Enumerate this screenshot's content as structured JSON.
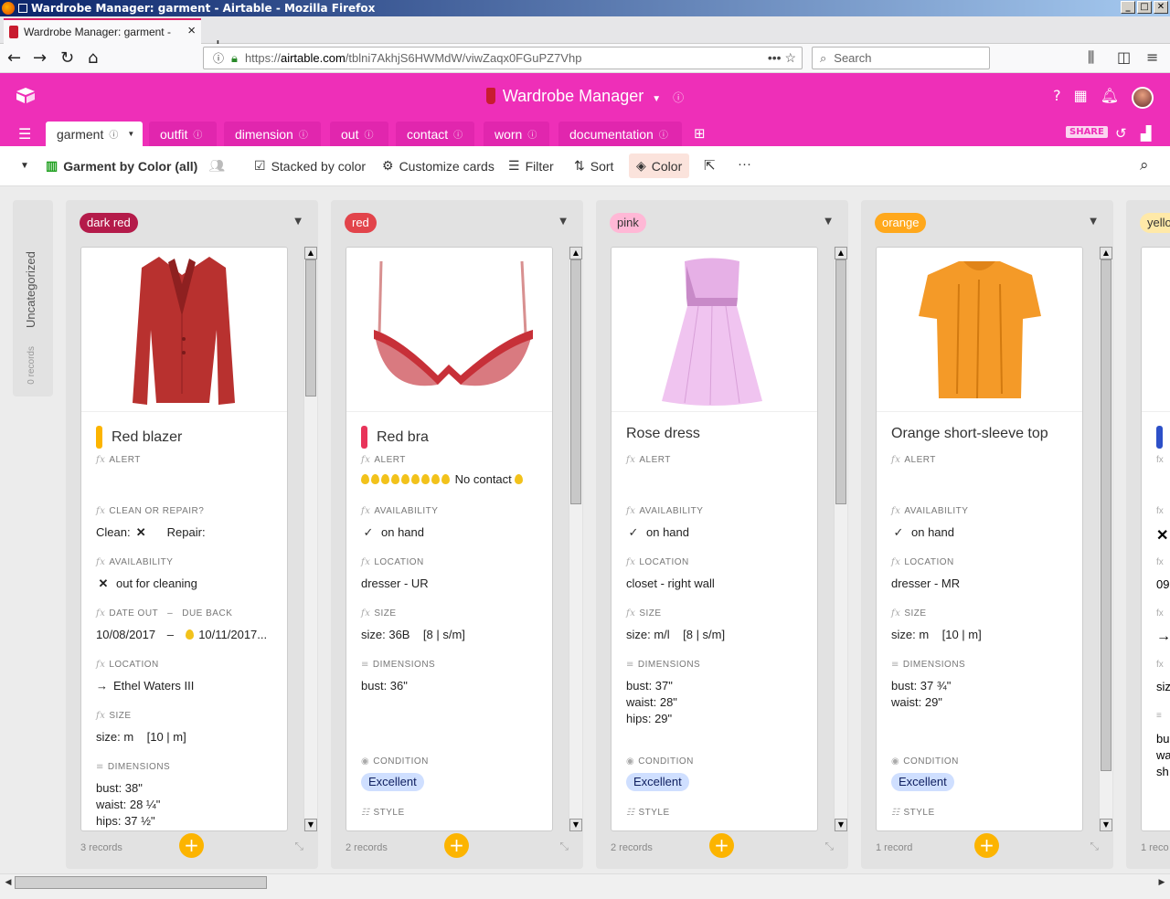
{
  "window": {
    "title": "Wardrobe Manager: garment - Airtable - Mozilla Firefox"
  },
  "browser": {
    "tab_title": "Wardrobe Manager: garment -",
    "url_prefix": "https://",
    "url_domain": "airtable.com",
    "url_path": "/tblni7AkhjS6HWMdW/viwZaqx0FGuPZ7Vhp",
    "search_placeholder": "Search"
  },
  "app": {
    "title": "Wardrobe Manager",
    "tabs": [
      "garment",
      "outfit",
      "dimension",
      "out",
      "contact",
      "worn",
      "documentation"
    ],
    "share_label": "SHARE"
  },
  "toolbar": {
    "view_name": "Garment by Color (all)",
    "stacked": "Stacked by color",
    "customize": "Customize cards",
    "filter": "Filter",
    "sort": "Sort",
    "color": "Color"
  },
  "uncategorized": {
    "label": "Uncategorized",
    "count": "0 records"
  },
  "columns": [
    {
      "label": "dark red",
      "pill_bg": "#b41b4a",
      "pill_fg": "#ffffff",
      "count": "3 records"
    },
    {
      "label": "red",
      "pill_bg": "#e2444b",
      "pill_fg": "#ffffff",
      "count": "2 records"
    },
    {
      "label": "pink",
      "pill_bg": "#ffb8d6",
      "pill_fg": "#333333",
      "count": "2 records"
    },
    {
      "label": "orange",
      "pill_bg": "#ffa81c",
      "pill_fg": "#ffffff",
      "count": "1 record"
    },
    {
      "label": "yello",
      "pill_bg": "#ffe9a8",
      "pill_fg": "#333333",
      "count": "1 reco"
    }
  ],
  "cards": {
    "c1": {
      "title": "Red blazer",
      "alert_label": "ALERT",
      "clean_label": "CLEAN OR REPAIR?",
      "clean": "Clean:",
      "repair": "Repair:",
      "avail_label": "AVAILABILITY",
      "avail": "out for cleaning",
      "dateout_label": "DATE OUT",
      "dash": "–",
      "dueback_label": "DUE BACK",
      "dateout": "10/08/2017",
      "dueback": "10/11/2017...",
      "loc_label": "LOCATION",
      "loc": "Ethel Waters III",
      "size_label": "SIZE",
      "size": "size: m    [10 | m]",
      "dim_label": "DIMENSIONS",
      "dim1": "bust: 38\"",
      "dim2": "waist: 28 ¼\"",
      "dim3": "hips: 37 ½\""
    },
    "c2": {
      "title": "Red bra",
      "alert_label": "ALERT",
      "alert": "No contact",
      "avail_label": "AVAILABILITY",
      "avail": "on hand",
      "loc_label": "LOCATION",
      "loc": "dresser - UR",
      "size_label": "SIZE",
      "size": "size: 36B    [8 | s/m]",
      "dim_label": "DIMENSIONS",
      "dim1": "bust: 36\"",
      "cond_label": "CONDITION",
      "cond": "Excellent",
      "style_label": "STYLE"
    },
    "c3": {
      "title": "Rose dress",
      "alert_label": "ALERT",
      "avail_label": "AVAILABILITY",
      "avail": "on hand",
      "loc_label": "LOCATION",
      "loc": "closet - right wall",
      "size_label": "SIZE",
      "size": "size: m/l    [8 | s/m]",
      "dim_label": "DIMENSIONS",
      "dim1": "bust: 37\"",
      "dim2": "waist: 28\"",
      "dim3": "hips: 29\"",
      "cond_label": "CONDITION",
      "cond": "Excellent",
      "style_label": "STYLE"
    },
    "c4": {
      "title": "Orange short-sleeve top",
      "alert_label": "ALERT",
      "avail_label": "AVAILABILITY",
      "avail": "on hand",
      "loc_label": "LOCATION",
      "loc": "dresser - MR",
      "size_label": "SIZE",
      "size": "size: m    [10 | m]",
      "dim_label": "DIMENSIONS",
      "dim1": "bust: 37 ¾\"",
      "dim2": "waist: 29\"",
      "cond_label": "CONDITION",
      "cond": "Excellent",
      "style_label": "STYLE"
    },
    "c5": {
      "date": "09",
      "size": "siz",
      "dim1": "bu",
      "dim2": "wa",
      "dim3": "sh"
    }
  },
  "colors": {
    "brand": "#ee2fb8",
    "add_button": "#fcb400"
  }
}
